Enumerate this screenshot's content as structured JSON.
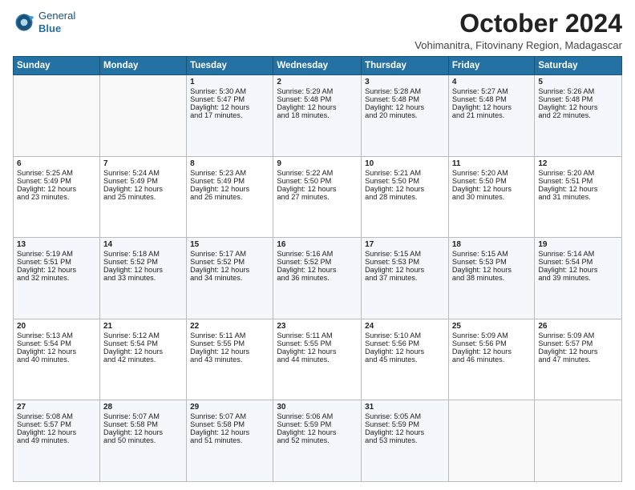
{
  "logo": {
    "general": "General",
    "blue": "Blue"
  },
  "title": "October 2024",
  "subtitle": "Vohimanitra, Fitovinany Region, Madagascar",
  "days_header": [
    "Sunday",
    "Monday",
    "Tuesday",
    "Wednesday",
    "Thursday",
    "Friday",
    "Saturday"
  ],
  "weeks": [
    [
      {
        "day": "",
        "content": ""
      },
      {
        "day": "",
        "content": ""
      },
      {
        "day": "1",
        "content": "Sunrise: 5:30 AM\nSunset: 5:47 PM\nDaylight: 12 hours\nand 17 minutes."
      },
      {
        "day": "2",
        "content": "Sunrise: 5:29 AM\nSunset: 5:48 PM\nDaylight: 12 hours\nand 18 minutes."
      },
      {
        "day": "3",
        "content": "Sunrise: 5:28 AM\nSunset: 5:48 PM\nDaylight: 12 hours\nand 20 minutes."
      },
      {
        "day": "4",
        "content": "Sunrise: 5:27 AM\nSunset: 5:48 PM\nDaylight: 12 hours\nand 21 minutes."
      },
      {
        "day": "5",
        "content": "Sunrise: 5:26 AM\nSunset: 5:48 PM\nDaylight: 12 hours\nand 22 minutes."
      }
    ],
    [
      {
        "day": "6",
        "content": "Sunrise: 5:25 AM\nSunset: 5:49 PM\nDaylight: 12 hours\nand 23 minutes."
      },
      {
        "day": "7",
        "content": "Sunrise: 5:24 AM\nSunset: 5:49 PM\nDaylight: 12 hours\nand 25 minutes."
      },
      {
        "day": "8",
        "content": "Sunrise: 5:23 AM\nSunset: 5:49 PM\nDaylight: 12 hours\nand 26 minutes."
      },
      {
        "day": "9",
        "content": "Sunrise: 5:22 AM\nSunset: 5:50 PM\nDaylight: 12 hours\nand 27 minutes."
      },
      {
        "day": "10",
        "content": "Sunrise: 5:21 AM\nSunset: 5:50 PM\nDaylight: 12 hours\nand 28 minutes."
      },
      {
        "day": "11",
        "content": "Sunrise: 5:20 AM\nSunset: 5:50 PM\nDaylight: 12 hours\nand 30 minutes."
      },
      {
        "day": "12",
        "content": "Sunrise: 5:20 AM\nSunset: 5:51 PM\nDaylight: 12 hours\nand 31 minutes."
      }
    ],
    [
      {
        "day": "13",
        "content": "Sunrise: 5:19 AM\nSunset: 5:51 PM\nDaylight: 12 hours\nand 32 minutes."
      },
      {
        "day": "14",
        "content": "Sunrise: 5:18 AM\nSunset: 5:52 PM\nDaylight: 12 hours\nand 33 minutes."
      },
      {
        "day": "15",
        "content": "Sunrise: 5:17 AM\nSunset: 5:52 PM\nDaylight: 12 hours\nand 34 minutes."
      },
      {
        "day": "16",
        "content": "Sunrise: 5:16 AM\nSunset: 5:52 PM\nDaylight: 12 hours\nand 36 minutes."
      },
      {
        "day": "17",
        "content": "Sunrise: 5:15 AM\nSunset: 5:53 PM\nDaylight: 12 hours\nand 37 minutes."
      },
      {
        "day": "18",
        "content": "Sunrise: 5:15 AM\nSunset: 5:53 PM\nDaylight: 12 hours\nand 38 minutes."
      },
      {
        "day": "19",
        "content": "Sunrise: 5:14 AM\nSunset: 5:54 PM\nDaylight: 12 hours\nand 39 minutes."
      }
    ],
    [
      {
        "day": "20",
        "content": "Sunrise: 5:13 AM\nSunset: 5:54 PM\nDaylight: 12 hours\nand 40 minutes."
      },
      {
        "day": "21",
        "content": "Sunrise: 5:12 AM\nSunset: 5:54 PM\nDaylight: 12 hours\nand 42 minutes."
      },
      {
        "day": "22",
        "content": "Sunrise: 5:11 AM\nSunset: 5:55 PM\nDaylight: 12 hours\nand 43 minutes."
      },
      {
        "day": "23",
        "content": "Sunrise: 5:11 AM\nSunset: 5:55 PM\nDaylight: 12 hours\nand 44 minutes."
      },
      {
        "day": "24",
        "content": "Sunrise: 5:10 AM\nSunset: 5:56 PM\nDaylight: 12 hours\nand 45 minutes."
      },
      {
        "day": "25",
        "content": "Sunrise: 5:09 AM\nSunset: 5:56 PM\nDaylight: 12 hours\nand 46 minutes."
      },
      {
        "day": "26",
        "content": "Sunrise: 5:09 AM\nSunset: 5:57 PM\nDaylight: 12 hours\nand 47 minutes."
      }
    ],
    [
      {
        "day": "27",
        "content": "Sunrise: 5:08 AM\nSunset: 5:57 PM\nDaylight: 12 hours\nand 49 minutes."
      },
      {
        "day": "28",
        "content": "Sunrise: 5:07 AM\nSunset: 5:58 PM\nDaylight: 12 hours\nand 50 minutes."
      },
      {
        "day": "29",
        "content": "Sunrise: 5:07 AM\nSunset: 5:58 PM\nDaylight: 12 hours\nand 51 minutes."
      },
      {
        "day": "30",
        "content": "Sunrise: 5:06 AM\nSunset: 5:59 PM\nDaylight: 12 hours\nand 52 minutes."
      },
      {
        "day": "31",
        "content": "Sunrise: 5:05 AM\nSunset: 5:59 PM\nDaylight: 12 hours\nand 53 minutes."
      },
      {
        "day": "",
        "content": ""
      },
      {
        "day": "",
        "content": ""
      }
    ]
  ]
}
